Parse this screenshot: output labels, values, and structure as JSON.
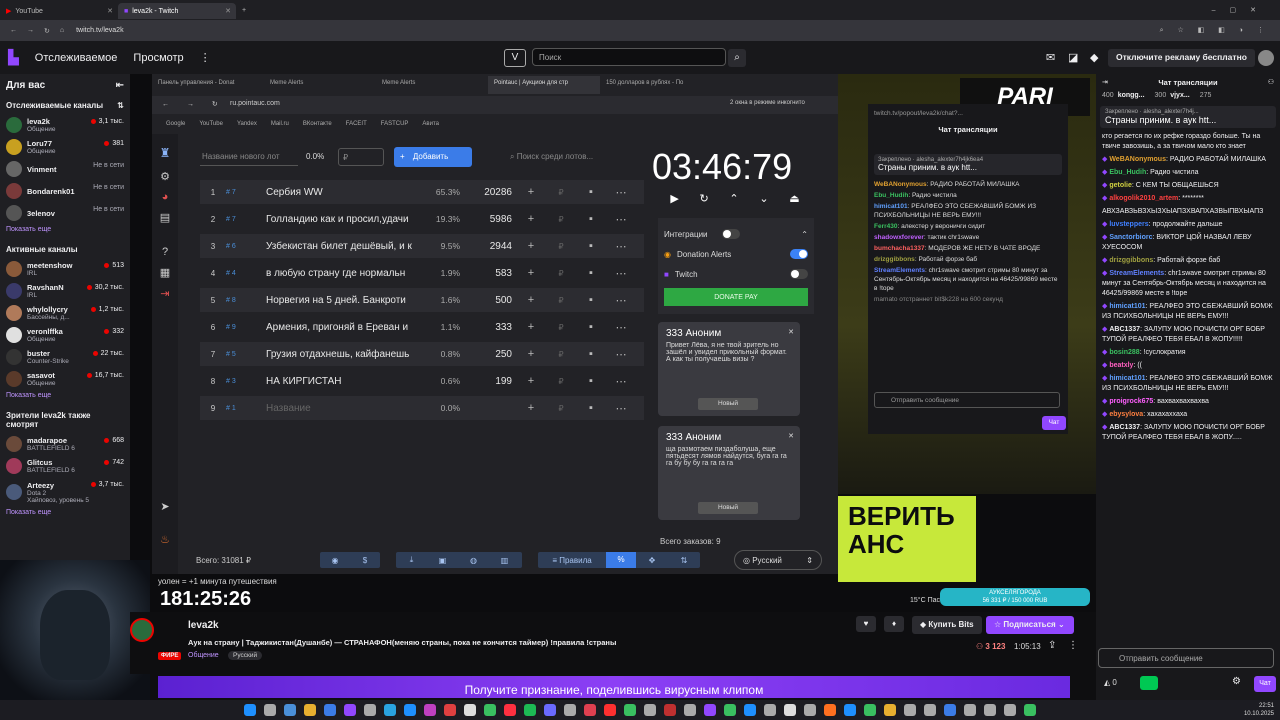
{
  "browser": {
    "tabs": [
      {
        "title": "YouTube",
        "color": "#ff0000"
      },
      {
        "title": "leva2k - Twitch",
        "color": "#9147ff"
      }
    ],
    "url": "twitch.tv/leva2k"
  },
  "twitch": {
    "nav": {
      "following": "Отслеживаемое",
      "browse": "Просмотр"
    },
    "search_placeholder": "Поиск",
    "ad_free": "Отключите рекламу бесплатно"
  },
  "sidebar": {
    "title": "Для вас",
    "followed_header": "Отслеживаемые каналы",
    "followed": [
      {
        "name": "leva2k",
        "sub": "Общение",
        "viewers": "3,1 тыс.",
        "live": true,
        "color": "#2a6b3c"
      },
      {
        "name": "Loru77",
        "sub": "Общение",
        "viewers": "381",
        "live": true,
        "color": "#c8a020"
      },
      {
        "name": "Vinment",
        "sub": "",
        "viewers": "Не в сети",
        "live": false,
        "color": "#666"
      },
      {
        "name": "Bondarenk01",
        "sub": "",
        "viewers": "Не в сети",
        "live": false,
        "color": "#7a3a3a"
      },
      {
        "name": "3elenov",
        "sub": "",
        "viewers": "Не в сети",
        "live": false,
        "color": "#555"
      }
    ],
    "show_more": "Показать еще",
    "active_header": "Активные каналы",
    "active": [
      {
        "name": "meetenshow",
        "sub": "IRL",
        "viewers": "513",
        "color": "#8a5a3a"
      },
      {
        "name": "RavshanN",
        "sub": "IRL",
        "viewers": "30,2 тыс.",
        "color": "#3a3a6a"
      },
      {
        "name": "whylollycry",
        "sub": "Бассейны, д...",
        "viewers": "1,2 тыс.",
        "color": "#b07a5a"
      },
      {
        "name": "veronlffka",
        "sub": "Общение",
        "viewers": "332",
        "color": "#e0e0e0"
      },
      {
        "name": "buster",
        "sub": "Counter-Strike",
        "viewers": "22 тыс.",
        "color": "#333"
      },
      {
        "name": "sasavot",
        "sub": "Общение",
        "viewers": "16,7 тыс.",
        "color": "#5a3a2a"
      }
    ],
    "also_header": "Зрители leva2k также смотрят",
    "also": [
      {
        "name": "madarapoe",
        "sub": "BATTLEFIELD 6",
        "viewers": "668",
        "color": "#6a4a3a"
      },
      {
        "name": "Glitcus",
        "sub": "BATTLEFIELD 6",
        "viewers": "742",
        "color": "#a03a5a"
      },
      {
        "name": "Arteezy",
        "sub": "Dota 2",
        "sub2": "Хайповоз, уровень 5",
        "viewers": "3,7 тыс.",
        "color": "#4a5a7a"
      }
    ]
  },
  "inner_browser": {
    "tabs": [
      "Панель управления - Donat",
      "Meme Alerts",
      "Meme Alerts",
      "Pointauc | Аукцион для стр",
      "150 долларов в рублях - По"
    ],
    "url": "ru.pointauc.com",
    "incognito": "2 окна в режиме инкогнито",
    "bookmarks": [
      "Google",
      "YouTube",
      "Yandex",
      "Mail.ru",
      "ВКонтакте",
      "FACEIT",
      "FASTCUP",
      "Авита"
    ]
  },
  "auction": {
    "new_lot_placeholder": "Название нового лот",
    "percent": "0.0%",
    "currency": "₽",
    "add": "Добавить",
    "search_placeholder": "Поиск среди лотов...",
    "lots": [
      {
        "n": "1",
        "id": "7",
        "name": "Сербия WW",
        "pct": "65.3%",
        "amount": "20286"
      },
      {
        "n": "2",
        "id": "7",
        "name": "Голландию как и просил,удачи",
        "pct": "19.3%",
        "amount": "5986"
      },
      {
        "n": "3",
        "id": "6",
        "name": "Узбекистан билет дешёвый, и к",
        "pct": "9.5%",
        "amount": "2944"
      },
      {
        "n": "4",
        "id": "4",
        "name": "в любую страну где нормальн",
        "pct": "1.9%",
        "amount": "583"
      },
      {
        "n": "5",
        "id": "8",
        "name": "Норвегия на 5 дней. Банкроти",
        "pct": "1.6%",
        "amount": "500"
      },
      {
        "n": "6",
        "id": "9",
        "name": "Армения, пригоняй в Ереван и",
        "pct": "1.1%",
        "amount": "333"
      },
      {
        "n": "7",
        "id": "5",
        "name": "Грузия отдахнешь, кайфанешь",
        "pct": "0.8%",
        "amount": "250"
      },
      {
        "n": "8",
        "id": "3",
        "name": "НА КИРГИСТАН",
        "pct": "0.6%",
        "amount": "199"
      },
      {
        "n": "9",
        "id": "1",
        "name": "Название",
        "pct": "0.0%",
        "amount": ""
      }
    ],
    "timer": "03:46:79",
    "integrations": "Интеграции",
    "donation_alerts": "Donation Alerts",
    "twitch": "Twitch",
    "donate_pay": "DONATE PAY",
    "cards": [
      {
        "name": "333 Аноним",
        "text": "Привет Лёва, я не твой зритель но зашёл и увидел прикольный формат. А как ты получаешь визы ?",
        "badge": "Новый"
      },
      {
        "name": "333 Аноним",
        "text": "ща размотаем пиздаболуша, еще пятьдесят лямов найдутся, буга га га га бу бу бу га га га га",
        "badge": "Новый"
      }
    ],
    "total": "Всего: 31081 ₽",
    "rules": "Правила",
    "orders": "Всего заказов: 9",
    "language": "Русский"
  },
  "popchat": {
    "title": "Чат трансляции",
    "url": "twitch.tv/popout/leva2k/chat?...",
    "pinned_label": "Закреплено",
    "pinned_by": "alesha_alexter7h4jk6ea4",
    "pinned_text": "Страны приним. в аук htt...",
    "lines": [
      {
        "user": "WeBANonymous",
        "text": "РАДИО РАБОТАЙ МИЛАШКА",
        "color": "#e0a030"
      },
      {
        "user": "Ebu_Hudih",
        "text": "Радио чистила",
        "color": "#3ac060"
      },
      {
        "user": "himicat101",
        "text": "РЕАЛФЕО ЭТО СБЕЖАВШИЙ БОМЖ ИЗ ПСИХБОЛЬНИЦЫ НЕ ВЕРЬ ЕМУ!!!",
        "color": "#60a0ff"
      },
      {
        "user": "Ferr430",
        "text": "алекстер у вероничги сидит",
        "color": "#3ac060"
      },
      {
        "user": "shadowxforever",
        "text": "тактик chr1swave",
        "color": "#c060ff"
      },
      {
        "user": "bumchacha1337",
        "text": "МОДЕРОВ ЖЕ НЕТУ В ЧАТЕ ВРОДЕ",
        "color": "#ff6060"
      },
      {
        "user": "drizggibbons",
        "text": "Работай форзе баб",
        "color": "#a0a040"
      },
      {
        "user": "StreamElements",
        "text": "chr1swave смотрит стримы 80 минут за Сентябрь-Октябрь месяц и находится на 46425/99869 месте в !tope",
        "color": "#6080ff"
      },
      {
        "user": "",
        "text": "mamato отстраннет bit$k228 на 600 секунд",
        "color": "#888"
      }
    ],
    "input": "Отправить сообщение",
    "chat_btn": "Чат"
  },
  "stream_overlay": {
    "pari": "PARI",
    "big_timer": "181:25:26",
    "timer_note": "уолен = +1 минута путешествия",
    "green_box": "ВЕРИТЬ\nАНС",
    "weather": "15°C  Пасмурно",
    "goal": "АУКСЕЛЯГОРОДА",
    "goal_amount": "56 331 ₽ / 150 000 RUB"
  },
  "stream_info": {
    "channel": "leva2k",
    "title": "Аук на страну | Таджикистан(Душанбе) — СТРАНАФОН(меняю страны, пока не кончится таймер) !правила !страны",
    "tags": [
      "Общение",
      "Русский"
    ],
    "live": "ФИРЕ",
    "buy_bits": "Купить Bits",
    "subscribe": "Подписаться",
    "viewers": "3 123",
    "uptime": "1:05:13"
  },
  "banner": "Получите признание, поделившись вирусным клипом",
  "chat": {
    "title": "Чат трансляции",
    "leaderboard": [
      {
        "name": "400",
        "sub": "kongg...",
        "color": "#b0b0b0"
      },
      {
        "name": "300",
        "sub": "vjyx...",
        "color": "#b0b0b0"
      },
      {
        "name": "275",
        "sub": "",
        "color": "#b0b0b0"
      }
    ],
    "pinned_label": "Закреплено",
    "pinned_by": "alesha_alexter7h4j...",
    "pinned_text": "Страны приним. в аук htt...",
    "lines": [
      {
        "user": "",
        "text": "кто регается по их рефке гораздо больше. Ты на твиче завозишь, а за твичом мало кто знает",
        "color": "#efeff1"
      },
      {
        "user": "WeBANonymous",
        "text": "РАДИО РАБОТАЙ МИЛАШКА",
        "color": "#e0a030"
      },
      {
        "user": "Ebu_Hudih",
        "text": "Радио чистила",
        "color": "#3ac060"
      },
      {
        "user": "getolie",
        "text": "С КЕМ ТЫ ОБЩАЕШЬСЯ",
        "color": "#d0d040"
      },
      {
        "user": "alkogolik2010_artem",
        "text": "********",
        "color": "#ff4040"
      },
      {
        "user": "",
        "text": "АВХЗАВЗЬВЗХЫЗХЫАПЗХВАПХАЗВЫПВХЫАПЗ",
        "color": "#efeff1"
      },
      {
        "user": "luvsteppers",
        "text": "продолжайте дальше",
        "color": "#4080ff"
      },
      {
        "user": "Sanctorbiorc",
        "text": "ВИКТОР ЦОЙ НАЗВАЛ ЛЕВУ ХУЕСОСОМ",
        "color": "#60a0ff"
      },
      {
        "user": "drizggibbons",
        "text": "Работай форзе баб",
        "color": "#a0a040"
      },
      {
        "user": "StreamElements",
        "text": "chr1swave смотрит стримы 80 минут за Сентябрь-Октябрь месяц и находится на 46425/99869 месте в !tope",
        "color": "#6080ff"
      },
      {
        "user": "himicat101",
        "text": "РЕАЛФЕО ЭТО СБЕЖАВШИЙ БОМЖ ИЗ ПСИХБОЛЬНИЦЫ НЕ ВЕРЬ ЕМУ!!!",
        "color": "#60a0ff"
      },
      {
        "user": "ABC1337",
        "text": "ЗАЛУПУ МОЮ ПОЧИСТИ ОРГ БОБР ТУПОЙ РЕАЛФЕО ТЕБЯ ЕБАЛ В ЖОПУ!!!!!",
        "color": "#efeff1"
      },
      {
        "user": "bosin288",
        "text": "!суслократия",
        "color": "#3ac060"
      },
      {
        "user": "beatxly",
        "text": "((",
        "color": "#ff60c0"
      },
      {
        "user": "himicat101",
        "text": "РЕАЛФЕО ЭТО СБЕЖАВШИЙ БОМЖ ИЗ ПСИХБОЛЬНИЦЫ НЕ ВЕРЬ ЕМУ!!!",
        "color": "#60a0ff"
      },
      {
        "user": "proigrock675",
        "text": "вахвахвахвахва",
        "color": "#ff60ff"
      },
      {
        "user": "ebysylova",
        "text": "хахахаххаха",
        "color": "#ff8040"
      },
      {
        "user": "ABC1337",
        "text": "ЗАЛУПУ МОЮ ПОЧИСТИ ОРГ БОБР ТУПОЙ РЕАЛФЕО ТЕБЯ ЕБАЛ В ЖОПУ.....",
        "color": "#efeff1"
      }
    ],
    "input_placeholder": "Отправить сообщение",
    "points": "0",
    "chat_btn": "Чат"
  },
  "taskbar": {
    "time": "22:51",
    "date": "10.10.2025"
  }
}
